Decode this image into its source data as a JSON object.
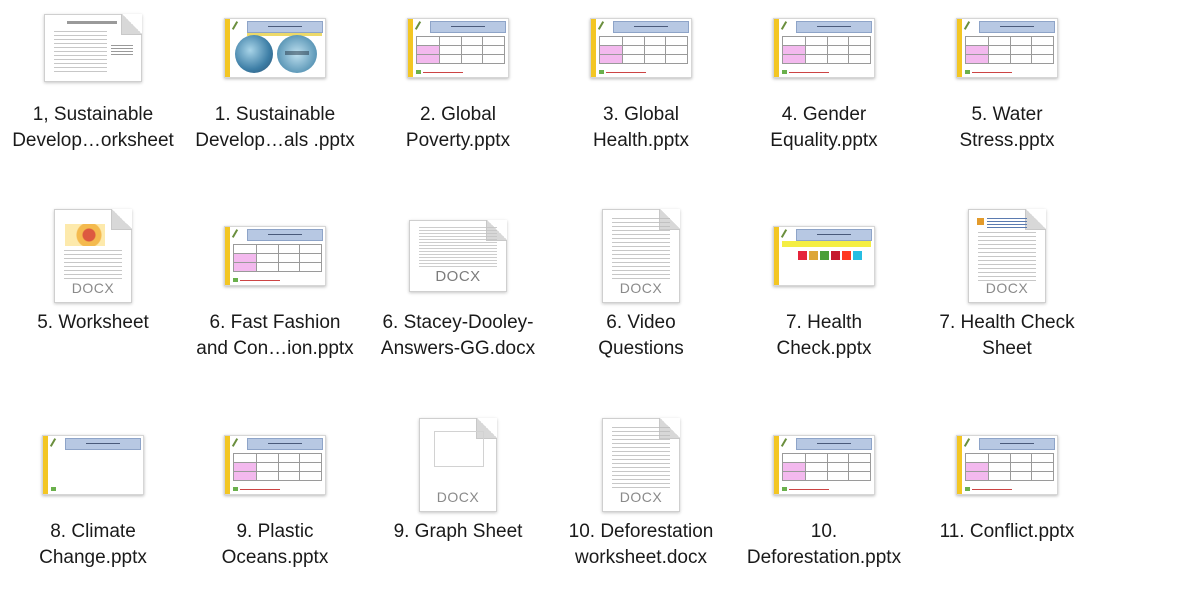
{
  "files": [
    {
      "name_lines": [
        "1, Sustainable",
        "Develop…orksheet"
      ],
      "kind": "worksheet",
      "type_label": ""
    },
    {
      "name_lines": [
        "1. Sustainable",
        "Develop…als .pptx"
      ],
      "kind": "pptx-image",
      "type_label": ""
    },
    {
      "name_lines": [
        "2. Global",
        "Poverty.pptx"
      ],
      "kind": "pptx",
      "type_label": ""
    },
    {
      "name_lines": [
        "3. Global",
        "Health.pptx"
      ],
      "kind": "pptx",
      "type_label": ""
    },
    {
      "name_lines": [
        "4. Gender",
        "Equality.pptx"
      ],
      "kind": "pptx",
      "type_label": ""
    },
    {
      "name_lines": [
        "5. Water",
        "Stress.pptx"
      ],
      "kind": "pptx",
      "type_label": ""
    },
    {
      "name_lines": [
        "5. Worksheet"
      ],
      "kind": "docx-map",
      "type_label": "DOCX"
    },
    {
      "name_lines": [
        "6. Fast Fashion",
        "and Con…ion.pptx"
      ],
      "kind": "pptx",
      "type_label": ""
    },
    {
      "name_lines": [
        "6. Stacey-Dooley-",
        "Answers-GG.docx"
      ],
      "kind": "docx-wide",
      "type_label": "DOCX"
    },
    {
      "name_lines": [
        "6. Video",
        "Questions"
      ],
      "kind": "docx",
      "type_label": "DOCX"
    },
    {
      "name_lines": [
        "7. Health",
        "Check.pptx"
      ],
      "kind": "pptx-sdg",
      "type_label": ""
    },
    {
      "name_lines": [
        "7. Health Check",
        "Sheet"
      ],
      "kind": "docx-health",
      "type_label": "DOCX"
    },
    {
      "name_lines": [
        "8. Climate",
        "Change.pptx"
      ],
      "kind": "pptx-empty",
      "type_label": ""
    },
    {
      "name_lines": [
        "9. Plastic",
        "Oceans.pptx"
      ],
      "kind": "pptx",
      "type_label": ""
    },
    {
      "name_lines": [
        "9. Graph Sheet"
      ],
      "kind": "docx-blank",
      "type_label": "DOCX"
    },
    {
      "name_lines": [
        "10. Deforestation",
        "worksheet.docx"
      ],
      "kind": "docx",
      "type_label": "DOCX"
    },
    {
      "name_lines": [
        "10.",
        "Deforestation.pptx"
      ],
      "kind": "pptx",
      "type_label": ""
    },
    {
      "name_lines": [
        "11. Conflict.pptx"
      ],
      "kind": "pptx",
      "type_label": ""
    }
  ]
}
